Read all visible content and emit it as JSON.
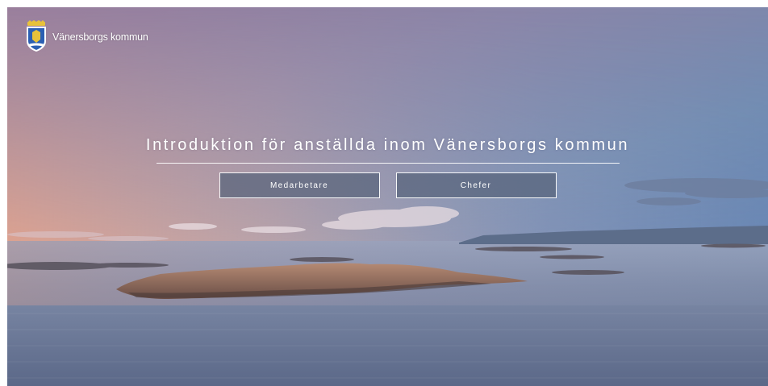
{
  "brand": {
    "name": "Vänersborgs kommun",
    "logo_icon": "coat-of-arms-icon"
  },
  "hero": {
    "title": "Introduktion för anställda inom Vänersborgs kommun"
  },
  "actions": {
    "employees_label": "Medarbetare",
    "managers_label": "Chefer"
  },
  "colors": {
    "sky_top": "#5e7aa6",
    "sky_warm": "#e8a892",
    "sea": "#6f7e9c",
    "button_fill": "#56627a"
  }
}
